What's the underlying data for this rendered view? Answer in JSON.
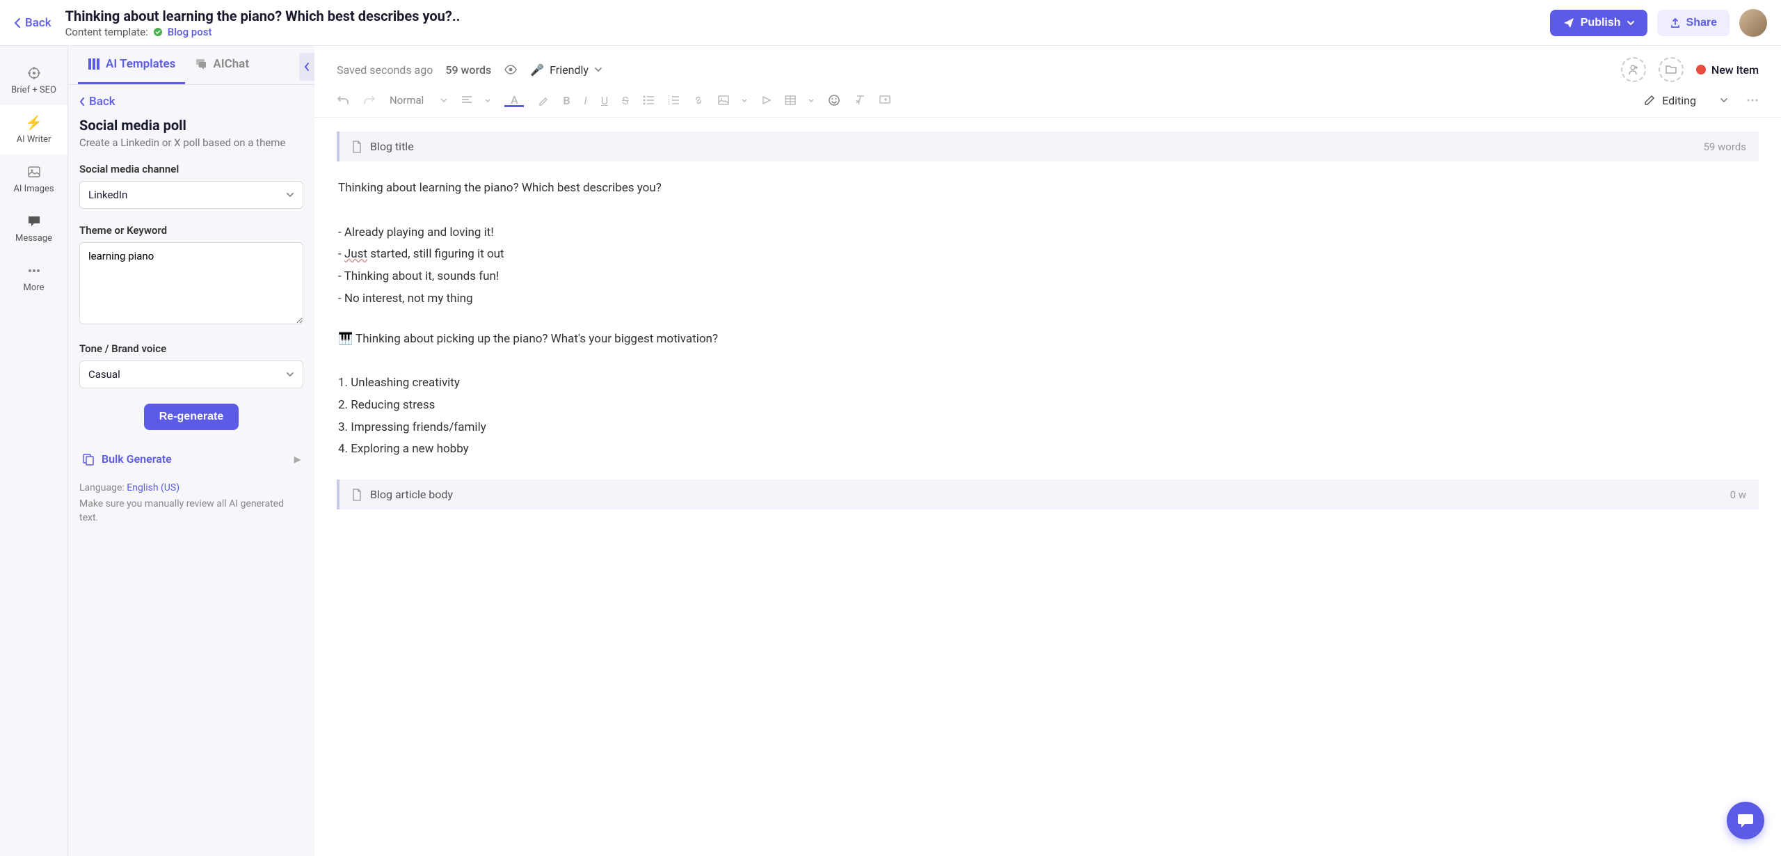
{
  "header": {
    "back_label": "Back",
    "title": "Thinking about learning the piano? Which best describes you?..",
    "template_prefix": "Content template:",
    "template_name": "Blog post",
    "publish_label": "Publish",
    "share_label": "Share"
  },
  "vert_nav": {
    "items": [
      {
        "label": "Brief + SEO"
      },
      {
        "label": "AI Writer"
      },
      {
        "label": "AI Images"
      },
      {
        "label": "Message"
      },
      {
        "label": "More"
      }
    ]
  },
  "panel": {
    "tabs": [
      {
        "label": "AI Templates",
        "active": true
      },
      {
        "label": "AIChat",
        "active": false
      }
    ],
    "back_label": "Back",
    "heading": "Social media poll",
    "sub": "Create a Linkedin or X poll based on a theme",
    "channel_label": "Social media channel",
    "channel_value": "LinkedIn",
    "theme_label": "Theme or Keyword",
    "theme_value": "learning piano",
    "tone_label": "Tone / Brand voice",
    "tone_value": "Casual",
    "regenerate_label": "Re-generate",
    "bulk_label": "Bulk Generate",
    "language_prefix": "Language:",
    "language_value": "English (US)",
    "review_note": "Make sure you manually review all AI generated text."
  },
  "editor": {
    "status": "Saved seconds ago",
    "word_count": "59 words",
    "tone_display": "Friendly",
    "new_item_label": "New Item",
    "style_dropdown": "Normal",
    "editing_label": "Editing",
    "title_section_label": "Blog title",
    "title_section_words": "59 words",
    "body_section_label": "Blog article body",
    "body_section_words": "0 w",
    "content": {
      "question": "Thinking about learning the piano? Which best describes you?",
      "options": [
        "- Already playing and loving it!",
        "- Just started, still figuring it out",
        "- Thinking about it, sounds fun!",
        "- No interest, not my thing"
      ],
      "second_question": "🎹 Thinking about picking up the piano? What's your biggest motivation?",
      "numbered": [
        "1. Unleashing creativity",
        "2. Reducing stress",
        "3. Impressing friends/family",
        "4. Exploring a new hobby"
      ]
    }
  }
}
